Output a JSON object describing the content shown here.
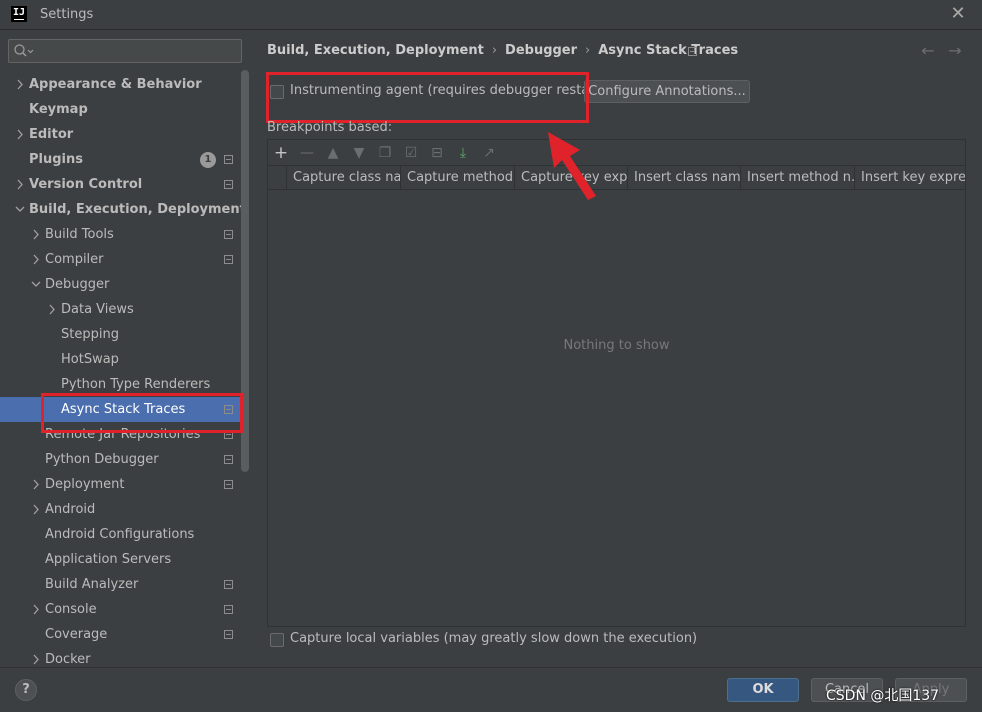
{
  "window": {
    "title": "Settings"
  },
  "search": {
    "placeholder": ""
  },
  "sidebar": {
    "items": [
      {
        "label": "Appearance & Behavior",
        "level": 0,
        "chevron": "right",
        "bold": true,
        "project": false,
        "badge": ""
      },
      {
        "label": "Keymap",
        "level": 0,
        "chevron": "",
        "bold": true,
        "project": false,
        "badge": ""
      },
      {
        "label": "Editor",
        "level": 0,
        "chevron": "right",
        "bold": true,
        "project": false,
        "badge": ""
      },
      {
        "label": "Plugins",
        "level": 0,
        "chevron": "",
        "bold": true,
        "project": true,
        "badge": "1"
      },
      {
        "label": "Version Control",
        "level": 0,
        "chevron": "right",
        "bold": true,
        "project": true,
        "badge": ""
      },
      {
        "label": "Build, Execution, Deployment",
        "level": 0,
        "chevron": "down",
        "bold": true,
        "project": false,
        "badge": ""
      },
      {
        "label": "Build Tools",
        "level": 1,
        "chevron": "right",
        "bold": false,
        "project": true,
        "badge": ""
      },
      {
        "label": "Compiler",
        "level": 1,
        "chevron": "right",
        "bold": false,
        "project": true,
        "badge": ""
      },
      {
        "label": "Debugger",
        "level": 1,
        "chevron": "down",
        "bold": false,
        "project": false,
        "badge": ""
      },
      {
        "label": "Data Views",
        "level": 2,
        "chevron": "right",
        "bold": false,
        "project": false,
        "badge": ""
      },
      {
        "label": "Stepping",
        "level": 2,
        "chevron": "",
        "bold": false,
        "project": false,
        "badge": ""
      },
      {
        "label": "HotSwap",
        "level": 2,
        "chevron": "",
        "bold": false,
        "project": false,
        "badge": ""
      },
      {
        "label": "Python Type Renderers",
        "level": 2,
        "chevron": "",
        "bold": false,
        "project": false,
        "badge": ""
      },
      {
        "label": "Async Stack Traces",
        "level": 2,
        "chevron": "",
        "bold": false,
        "project": true,
        "badge": "",
        "selected": true
      },
      {
        "label": "Remote Jar Repositories",
        "level": 1,
        "chevron": "",
        "bold": false,
        "project": true,
        "badge": ""
      },
      {
        "label": "Python Debugger",
        "level": 1,
        "chevron": "",
        "bold": false,
        "project": true,
        "badge": ""
      },
      {
        "label": "Deployment",
        "level": 1,
        "chevron": "right",
        "bold": false,
        "project": true,
        "badge": ""
      },
      {
        "label": "Android",
        "level": 1,
        "chevron": "right",
        "bold": false,
        "project": false,
        "badge": ""
      },
      {
        "label": "Android Configurations",
        "level": 1,
        "chevron": "",
        "bold": false,
        "project": false,
        "badge": ""
      },
      {
        "label": "Application Servers",
        "level": 1,
        "chevron": "",
        "bold": false,
        "project": false,
        "badge": ""
      },
      {
        "label": "Build Analyzer",
        "level": 1,
        "chevron": "",
        "bold": false,
        "project": true,
        "badge": ""
      },
      {
        "label": "Console",
        "level": 1,
        "chevron": "right",
        "bold": false,
        "project": true,
        "badge": ""
      },
      {
        "label": "Coverage",
        "level": 1,
        "chevron": "",
        "bold": false,
        "project": true,
        "badge": ""
      },
      {
        "label": "Docker",
        "level": 1,
        "chevron": "right",
        "bold": false,
        "project": false,
        "badge": ""
      }
    ]
  },
  "breadcrumb": {
    "items": [
      "Build, Execution, Deployment",
      "Debugger",
      "Async Stack Traces"
    ],
    "separator": "›"
  },
  "main": {
    "agent_checkbox_label": "Instrumenting agent (requires debugger restart)",
    "agent_checked": false,
    "configure_button": "Configure Annotations...",
    "breakpoints_label": "Breakpoints based:",
    "columns": [
      "Capture class na...",
      "Capture method...",
      "Capture key exp...",
      "Insert class name",
      "Insert method n...",
      "Insert key expre..."
    ],
    "empty_text": "Nothing to show",
    "capture_checkbox_label": "Capture local variables (may greatly slow down the execution)",
    "capture_checked": false
  },
  "toolbar_icons": [
    "add-icon",
    "remove-icon",
    "move-up-icon",
    "move-down-icon",
    "copy-icon",
    "enable-icon",
    "disable-icon",
    "import-icon",
    "export-icon"
  ],
  "footer": {
    "help": "?",
    "ok": "OK",
    "cancel": "Cancel",
    "apply": "Apply",
    "watermark": "CSDN @北国137"
  },
  "colors": {
    "background": "#3c3f41",
    "selection": "#4b6eaf",
    "ok_button": "#365880",
    "highlight_red": "#e0232b"
  }
}
